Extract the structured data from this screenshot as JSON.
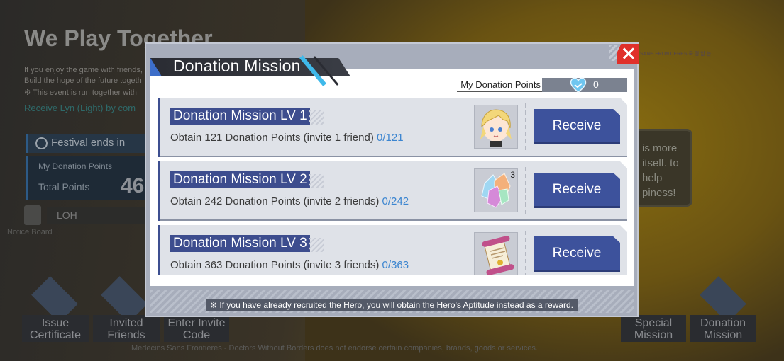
{
  "background": {
    "title": "We Play Together",
    "text_lines": [
      "If you enjoy the game with friends,",
      "Build the hope of the future togeth",
      "※ This event is run together with"
    ],
    "link_text": "Receive Lyn (Light) by com",
    "festival_label": "Festival ends in",
    "my_points_label": "My Donation Points",
    "total_points_label": "Total Points",
    "total_points_value": "46",
    "loh_label": "LOH",
    "notice_board_label": "Notice Board",
    "bottom_buttons": [
      {
        "label": "Issue Certificate"
      },
      {
        "label": "Invited Friends"
      },
      {
        "label": "Enter Invite Code"
      },
      {
        "label": "Special Mission"
      },
      {
        "label": "Donation Mission"
      }
    ],
    "footer_text": "Medecins Sans Frontieres - Doctors Without Borders does not endorse certain companies, brands, goods or services.",
    "bubble_text": "is more itself. to help piness!",
    "msf_logo_text": "SANS FRONTIERES 국 경 없 는"
  },
  "modal": {
    "title": "Donation Mission",
    "my_points_label": "My Donation Points",
    "my_points_value": "0",
    "missions": [
      {
        "title": "Donation Mission LV 1",
        "description": "Obtain 121 Donation Points (invite 1 friend)",
        "progress": "0/121",
        "reward_icon": "hero-portrait-icon",
        "reward_count": "",
        "button": "Receive"
      },
      {
        "title": "Donation Mission LV 2",
        "description": "Obtain 242 Donation Points (invite 2 friends)",
        "progress": "0/242",
        "reward_icon": "crystal-icon",
        "reward_count": "3",
        "button": "Receive"
      },
      {
        "title": "Donation Mission LV 3",
        "description": "Obtain 363 Donation Points (invite 3 friends)",
        "progress": "0/363",
        "reward_icon": "scroll-icon",
        "reward_count": "",
        "button": "Receive"
      }
    ],
    "note": "※ If you have already recruited the Hero, you will obtain the Hero's Aptitude instead as a reward."
  },
  "colors": {
    "accent_blue": "#3d529c",
    "progress_blue": "#3b85d0",
    "close_red": "#e0302a"
  }
}
